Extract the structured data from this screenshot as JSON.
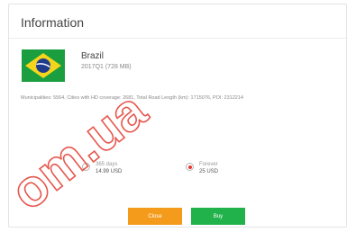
{
  "dialog": {
    "title": "Information",
    "country": {
      "name": "Brazil",
      "version_size": "2017Q1 (728 MB)",
      "flag_icon": "brazil-flag-icon"
    },
    "stats": "Municipalities: 5564, Cities with HD coverage: 2681, Total Road Length (km): 1715076, POI: 2312214",
    "options": [
      {
        "label": "365 days",
        "price": "14.99 USD",
        "selected": false
      },
      {
        "label": "Forever",
        "price": "25 USD",
        "selected": true
      }
    ],
    "buttons": {
      "cancel_label": "Close",
      "buy_label": "Buy"
    }
  },
  "watermark": {
    "text": "om.ua",
    "color": "#e23a2f"
  },
  "colors": {
    "accent_orange": "#f49b1b",
    "accent_green": "#21b24b",
    "radio_selected": "#e6362e"
  }
}
